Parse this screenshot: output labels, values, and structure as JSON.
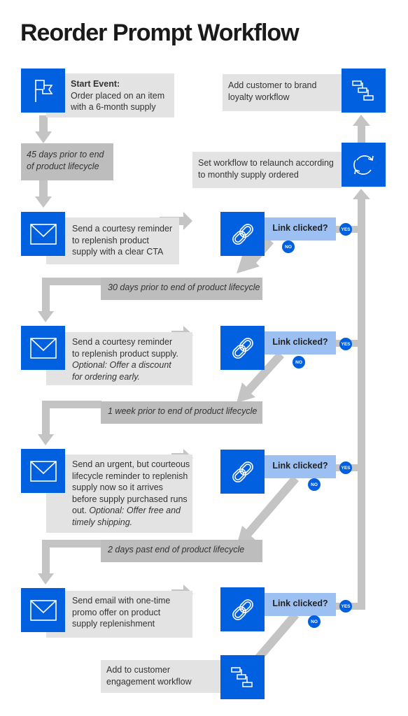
{
  "title": "Reorder Prompt Workflow",
  "colors": {
    "accent": "#0060e0",
    "decision": "#9dc0f2",
    "box": "#e3e3e3",
    "band": "#bdbdbd",
    "connector": "#c4c4c4"
  },
  "start": {
    "icon": "flag-icon",
    "heading": "Start Event:",
    "line1": "Order placed on an item",
    "line2": "with a 6-month supply"
  },
  "timing": {
    "t45_line1": "45 days prior to end",
    "t45_line2": "of product lifecycle",
    "t30": "30 days prior to end of product lifecycle",
    "t7": "1 week prior to end of product lifecycle",
    "t2": "2 days past end of product lifecycle"
  },
  "steps": [
    {
      "icon": "envelope-icon",
      "lines": [
        "Send a courtesy reminder",
        "to replenish product",
        "supply with a clear CTA"
      ]
    },
    {
      "icon": "envelope-icon",
      "lines": [
        "Send a courtesy reminder",
        "to replenish product supply."
      ],
      "optional": [
        "Optional: Offer a discount",
        "for ordering early."
      ]
    },
    {
      "icon": "envelope-icon",
      "lines": [
        "Send an urgent, but courteous",
        "lifecycle reminder to replenish",
        "supply now so it arrives",
        "before supply purchased runs"
      ],
      "tail": "out.",
      "optional": [
        "Optional: Offer free and",
        "timely shipping."
      ]
    },
    {
      "icon": "envelope-icon",
      "lines": [
        "Send email with one-time",
        "promo offer on product",
        "supply replenishment"
      ]
    }
  ],
  "decision": {
    "icon": "link-icon",
    "label": "Link clicked?",
    "yes": "YES",
    "no": "NO"
  },
  "relaunch": {
    "icon": "refresh-icon",
    "line1": "Set workflow to relaunch according",
    "line2": "to monthly supply ordered"
  },
  "loyalty": {
    "icon": "workflow-icon",
    "line1": "Add customer to brand",
    "line2": "loyalty workflow"
  },
  "engagement": {
    "icon": "workflow-icon",
    "line1": "Add to customer",
    "line2": "engagement workflow"
  }
}
